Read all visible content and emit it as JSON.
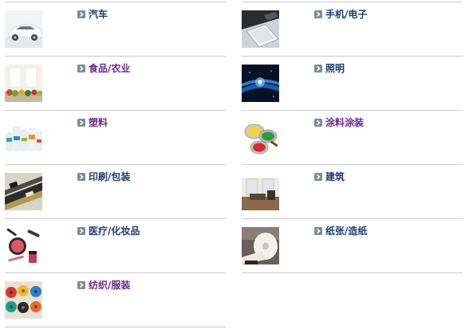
{
  "colors": {
    "link_default": "#1f3b73",
    "link_visited": "#6b2a8a",
    "arrow_bg": "#7f8a94",
    "divider": "#cccccc"
  },
  "icons": {
    "arrow": "chevron-right-icon"
  },
  "categories": {
    "left": [
      {
        "label": "汽车",
        "visited": false
      },
      {
        "label": "食品/农业",
        "visited": true
      },
      {
        "label": "塑料",
        "visited": true
      },
      {
        "label": "印刷/包装",
        "visited": false
      },
      {
        "label": "医疗/化妆品",
        "visited": false
      },
      {
        "label": "纺织/服装",
        "visited": true
      }
    ],
    "right": [
      {
        "label": "手机/电子",
        "visited": false
      },
      {
        "label": "照明",
        "visited": false
      },
      {
        "label": "涂料涂装",
        "visited": true
      },
      {
        "label": "建筑",
        "visited": false
      },
      {
        "label": "纸张/造纸",
        "visited": false
      }
    ]
  }
}
